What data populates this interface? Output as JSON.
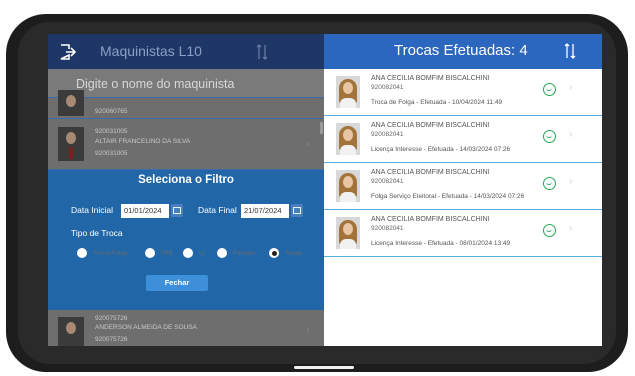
{
  "left_panel": {
    "title": "Maquinistas L10",
    "search_placeholder": "Digite o nome do maquinista",
    "employees": [
      {
        "line1": "",
        "line2": "920060765"
      },
      {
        "line1": "920031005",
        "line2": "ALTAIR FRANCELINO DA SILVA",
        "line3": "920031005"
      },
      {
        "line1": "920075726",
        "line2": "ANDERSON ALMEIDA DE SOUSA",
        "line3": "920075726"
      }
    ]
  },
  "filter": {
    "title": "Seleciona o Filtro",
    "start_label": "Data Inicial",
    "start_value": "01/01/2024",
    "end_label": "Data Final",
    "end_value": "21/07/2024",
    "type_label": "Tipo de Troca",
    "options": [
      "Troca Folga",
      "TRE",
      "LI",
      "Feriado",
      "Todas"
    ],
    "selected_option": "Todas",
    "close_button": "Fechar"
  },
  "right_panel": {
    "title": "Trocas Efetuadas: 4",
    "records": [
      {
        "name": "ANA CECILIA BOMFIM BISCALCHINI",
        "registration": "920082041",
        "detail": "Troca de Folga - Efetuada - 10/04/2024 11:49"
      },
      {
        "name": "ANA CECILIA BOMFIM BISCALCHINI",
        "registration": "920082041",
        "detail": "Licença Interesse - Efetuada - 14/03/2024 07:26"
      },
      {
        "name": "ANA CECILIA BOMFIM BISCALCHINI",
        "registration": "920082041",
        "detail": "Folga Serviço Eleitoral - Efetuada - 14/03/2024 07:26"
      },
      {
        "name": "ANA CECILIA BOMFIM BISCALCHINI",
        "registration": "920082041",
        "detail": "Licença Interesse - Efetuada - 08/01/2024 13:49"
      }
    ]
  },
  "colors": {
    "header_dark": "#1f3766",
    "header_blue": "#2b66bf",
    "filter_bg": "#2167a8",
    "divider": "#5aaee0",
    "status_green": "#22aa55"
  },
  "icons": {
    "exit": "exit-icon",
    "sort": "sort-icon",
    "calendar": "calendar-icon",
    "status": "smile-icon",
    "chevron": "chevron-right-icon"
  }
}
